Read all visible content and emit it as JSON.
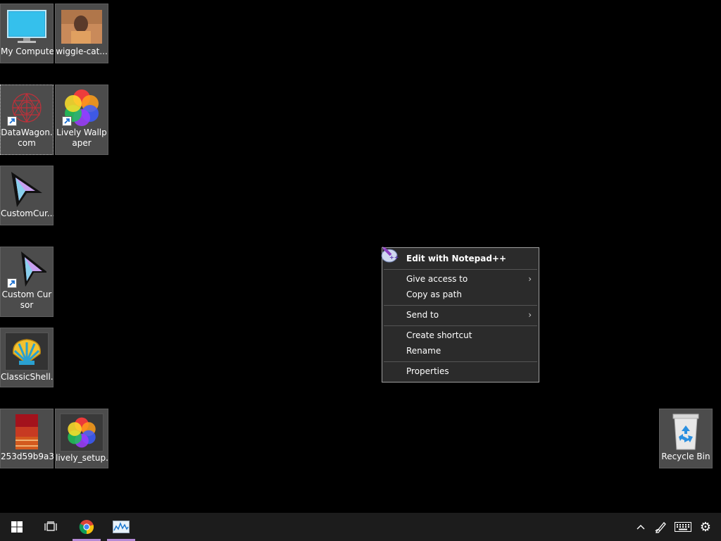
{
  "desktop_icons": [
    {
      "label": "My Computer",
      "icon": "monitor-icon"
    },
    {
      "label": "wiggle-cat...",
      "icon": "photo-thumbnail-icon"
    },
    {
      "label": "DataWagon.com",
      "icon": "datawagon-icon",
      "shortcut": true,
      "selected": true
    },
    {
      "label": "Lively Wallpaper",
      "icon": "lively-wallpaper-icon",
      "shortcut": true
    },
    {
      "label": "CustomCur...",
      "icon": "cursor-arrow-icon"
    },
    {
      "label": "Custom Cursor",
      "icon": "cursor-arrow-icon",
      "shortcut": true
    },
    {
      "label": "ClassicShell...",
      "icon": "classic-shell-icon"
    },
    {
      "label": "253d59b9a3...",
      "icon": "winrar-archive-icon"
    },
    {
      "label": "lively_setup...",
      "icon": "lively-setup-icon"
    },
    {
      "label": "Recycle Bin",
      "icon": "recycle-bin-icon"
    }
  ],
  "context_menu": {
    "items": [
      {
        "label": "Edit with Notepad++",
        "bold": true,
        "icon": "notepadplusplus-icon"
      },
      {
        "label": "Give access to",
        "submenu": true
      },
      {
        "label": "Copy as path"
      },
      {
        "label": "Send to",
        "submenu": true
      },
      {
        "label": "Create shortcut"
      },
      {
        "label": "Rename"
      },
      {
        "label": "Properties"
      }
    ],
    "submenu_glyph": "›"
  },
  "taskbar": {
    "apps": [
      {
        "name": "start-button",
        "icon": "windows-logo-icon"
      },
      {
        "name": "task-view-button",
        "icon": "task-view-icon"
      },
      {
        "name": "chrome-taskbar-button",
        "icon": "chrome-icon",
        "active": true
      },
      {
        "name": "resource-monitor-taskbar-button",
        "icon": "performance-monitor-icon",
        "active": true
      }
    ],
    "tray": [
      {
        "name": "show-hidden-icons-button",
        "icon": "chevron-up-icon",
        "glyph": "^"
      },
      {
        "name": "pen-workspace-button",
        "icon": "pen-icon"
      },
      {
        "name": "touch-keyboard-button",
        "icon": "keyboard-icon"
      },
      {
        "name": "settings-button",
        "icon": "gear-icon",
        "glyph": "⚙"
      }
    ]
  },
  "colors": {
    "desktop_bg": "#000000",
    "icon_tile_bg": "#4c4c4c",
    "menu_bg": "#2b2b2b",
    "taskbar_bg": "#1c1c1c",
    "taskbar_active_indicator": "#b58ad6"
  }
}
